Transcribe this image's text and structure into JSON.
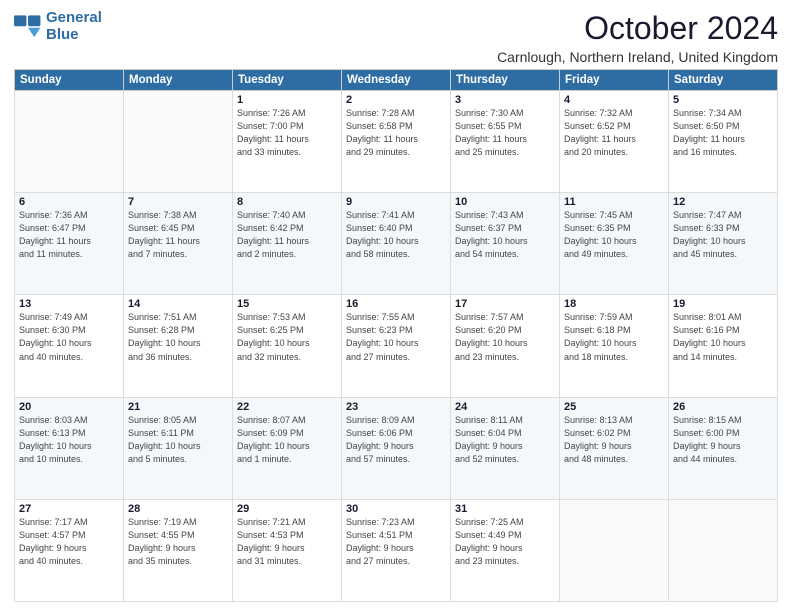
{
  "logo": {
    "line1": "General",
    "line2": "Blue"
  },
  "title": "October 2024",
  "location": "Carnlough, Northern Ireland, United Kingdom",
  "days_of_week": [
    "Sunday",
    "Monday",
    "Tuesday",
    "Wednesday",
    "Thursday",
    "Friday",
    "Saturday"
  ],
  "weeks": [
    [
      {
        "day": "",
        "info": ""
      },
      {
        "day": "",
        "info": ""
      },
      {
        "day": "1",
        "info": "Sunrise: 7:26 AM\nSunset: 7:00 PM\nDaylight: 11 hours\nand 33 minutes."
      },
      {
        "day": "2",
        "info": "Sunrise: 7:28 AM\nSunset: 6:58 PM\nDaylight: 11 hours\nand 29 minutes."
      },
      {
        "day": "3",
        "info": "Sunrise: 7:30 AM\nSunset: 6:55 PM\nDaylight: 11 hours\nand 25 minutes."
      },
      {
        "day": "4",
        "info": "Sunrise: 7:32 AM\nSunset: 6:52 PM\nDaylight: 11 hours\nand 20 minutes."
      },
      {
        "day": "5",
        "info": "Sunrise: 7:34 AM\nSunset: 6:50 PM\nDaylight: 11 hours\nand 16 minutes."
      }
    ],
    [
      {
        "day": "6",
        "info": "Sunrise: 7:36 AM\nSunset: 6:47 PM\nDaylight: 11 hours\nand 11 minutes."
      },
      {
        "day": "7",
        "info": "Sunrise: 7:38 AM\nSunset: 6:45 PM\nDaylight: 11 hours\nand 7 minutes."
      },
      {
        "day": "8",
        "info": "Sunrise: 7:40 AM\nSunset: 6:42 PM\nDaylight: 11 hours\nand 2 minutes."
      },
      {
        "day": "9",
        "info": "Sunrise: 7:41 AM\nSunset: 6:40 PM\nDaylight: 10 hours\nand 58 minutes."
      },
      {
        "day": "10",
        "info": "Sunrise: 7:43 AM\nSunset: 6:37 PM\nDaylight: 10 hours\nand 54 minutes."
      },
      {
        "day": "11",
        "info": "Sunrise: 7:45 AM\nSunset: 6:35 PM\nDaylight: 10 hours\nand 49 minutes."
      },
      {
        "day": "12",
        "info": "Sunrise: 7:47 AM\nSunset: 6:33 PM\nDaylight: 10 hours\nand 45 minutes."
      }
    ],
    [
      {
        "day": "13",
        "info": "Sunrise: 7:49 AM\nSunset: 6:30 PM\nDaylight: 10 hours\nand 40 minutes."
      },
      {
        "day": "14",
        "info": "Sunrise: 7:51 AM\nSunset: 6:28 PM\nDaylight: 10 hours\nand 36 minutes."
      },
      {
        "day": "15",
        "info": "Sunrise: 7:53 AM\nSunset: 6:25 PM\nDaylight: 10 hours\nand 32 minutes."
      },
      {
        "day": "16",
        "info": "Sunrise: 7:55 AM\nSunset: 6:23 PM\nDaylight: 10 hours\nand 27 minutes."
      },
      {
        "day": "17",
        "info": "Sunrise: 7:57 AM\nSunset: 6:20 PM\nDaylight: 10 hours\nand 23 minutes."
      },
      {
        "day": "18",
        "info": "Sunrise: 7:59 AM\nSunset: 6:18 PM\nDaylight: 10 hours\nand 18 minutes."
      },
      {
        "day": "19",
        "info": "Sunrise: 8:01 AM\nSunset: 6:16 PM\nDaylight: 10 hours\nand 14 minutes."
      }
    ],
    [
      {
        "day": "20",
        "info": "Sunrise: 8:03 AM\nSunset: 6:13 PM\nDaylight: 10 hours\nand 10 minutes."
      },
      {
        "day": "21",
        "info": "Sunrise: 8:05 AM\nSunset: 6:11 PM\nDaylight: 10 hours\nand 5 minutes."
      },
      {
        "day": "22",
        "info": "Sunrise: 8:07 AM\nSunset: 6:09 PM\nDaylight: 10 hours\nand 1 minute."
      },
      {
        "day": "23",
        "info": "Sunrise: 8:09 AM\nSunset: 6:06 PM\nDaylight: 9 hours\nand 57 minutes."
      },
      {
        "day": "24",
        "info": "Sunrise: 8:11 AM\nSunset: 6:04 PM\nDaylight: 9 hours\nand 52 minutes."
      },
      {
        "day": "25",
        "info": "Sunrise: 8:13 AM\nSunset: 6:02 PM\nDaylight: 9 hours\nand 48 minutes."
      },
      {
        "day": "26",
        "info": "Sunrise: 8:15 AM\nSunset: 6:00 PM\nDaylight: 9 hours\nand 44 minutes."
      }
    ],
    [
      {
        "day": "27",
        "info": "Sunrise: 7:17 AM\nSunset: 4:57 PM\nDaylight: 9 hours\nand 40 minutes."
      },
      {
        "day": "28",
        "info": "Sunrise: 7:19 AM\nSunset: 4:55 PM\nDaylight: 9 hours\nand 35 minutes."
      },
      {
        "day": "29",
        "info": "Sunrise: 7:21 AM\nSunset: 4:53 PM\nDaylight: 9 hours\nand 31 minutes."
      },
      {
        "day": "30",
        "info": "Sunrise: 7:23 AM\nSunset: 4:51 PM\nDaylight: 9 hours\nand 27 minutes."
      },
      {
        "day": "31",
        "info": "Sunrise: 7:25 AM\nSunset: 4:49 PM\nDaylight: 9 hours\nand 23 minutes."
      },
      {
        "day": "",
        "info": ""
      },
      {
        "day": "",
        "info": ""
      }
    ]
  ]
}
